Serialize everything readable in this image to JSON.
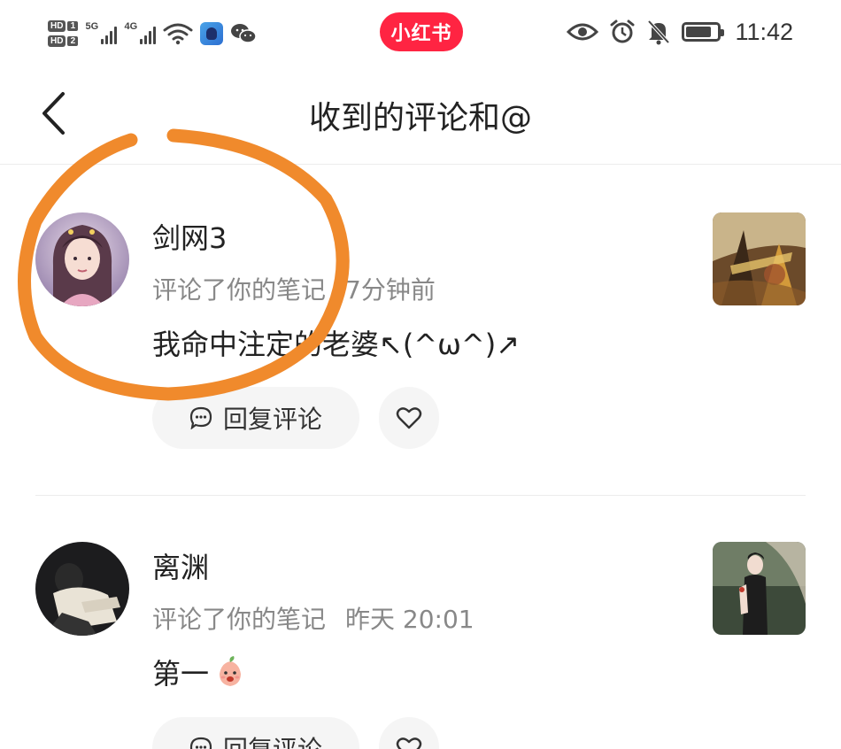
{
  "status_bar": {
    "hd1": "HD",
    "hd1_num": "1",
    "hd2": "HD",
    "hd2_num": "2",
    "signal1_gen": "5G",
    "signal2_gen": "4G",
    "app_badge": "小红书",
    "time": "11:42",
    "icons": [
      "wifi-icon",
      "app-icon",
      "wechat-icon",
      "eye-icon",
      "alarm-icon",
      "mute-icon",
      "battery-icon"
    ]
  },
  "nav": {
    "title": "收到的评论和@"
  },
  "comments": [
    {
      "user": "剑网3",
      "action": "评论了你的笔记",
      "time": "7分钟前",
      "text": "我命中注定的老婆↖(^ω^)↗",
      "reply_label": "回复评论"
    },
    {
      "user": "离渊",
      "action": "评论了你的笔记",
      "time": "昨天 20:01",
      "text": "第一",
      "reply_label": "回复评论"
    }
  ],
  "colors": {
    "brand": "#ff2442",
    "annotation": "#f08a2c",
    "muted_text": "#888888",
    "button_bg": "#f5f5f5"
  }
}
